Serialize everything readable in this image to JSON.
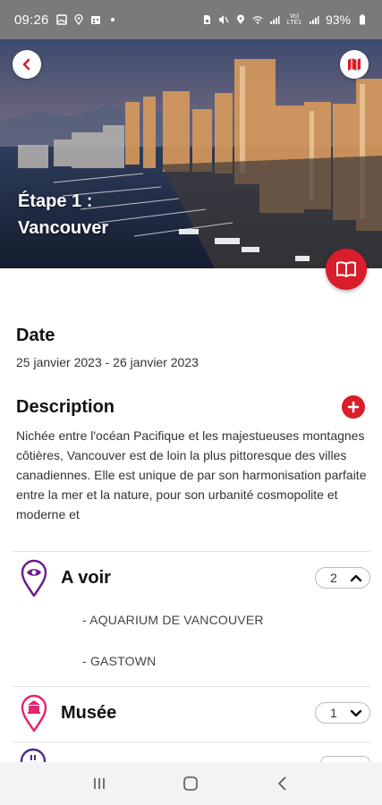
{
  "status_bar": {
    "time": "09:26",
    "battery": "93%",
    "left_icons": [
      "image-icon",
      "location-icon",
      "calendar-icon",
      "dot-icon"
    ],
    "right_icons": [
      "sim-icon",
      "mute-icon",
      "location-icon",
      "wifi-icon",
      "signal-icon",
      "volte-icon",
      "signal-icon",
      "battery-icon"
    ],
    "volte_label": "Vo) LTE1"
  },
  "hero": {
    "title_line1": "Étape 1 :",
    "title_line2": "Vancouver"
  },
  "date_section": {
    "heading": "Date",
    "value": "25 janvier 2023 - 26 janvier 2023"
  },
  "description_section": {
    "heading": "Description",
    "text": "Nichée entre l'océan Pacifique et les majestueuses montagnes côtières, Vancouver est de loin la plus pittoresque des villes canadiennes. Elle est unique de par son harmonisation parfaite entre la mer et la nature, pour son urbanité cosmopolite et moderne et"
  },
  "categories": [
    {
      "label": "A voir",
      "count": "2",
      "expanded": true,
      "color": "#6a1b8a",
      "items": [
        "- AQUARIUM DE VANCOUVER",
        "- GASTOWN"
      ]
    },
    {
      "label": "Musée",
      "count": "1",
      "expanded": false,
      "color": "#e3246f",
      "items": []
    }
  ],
  "colors": {
    "accent": "#d91d2a",
    "status_bar": "#7a7a7a",
    "purple": "#6a1b8a",
    "pink": "#e3246f"
  }
}
